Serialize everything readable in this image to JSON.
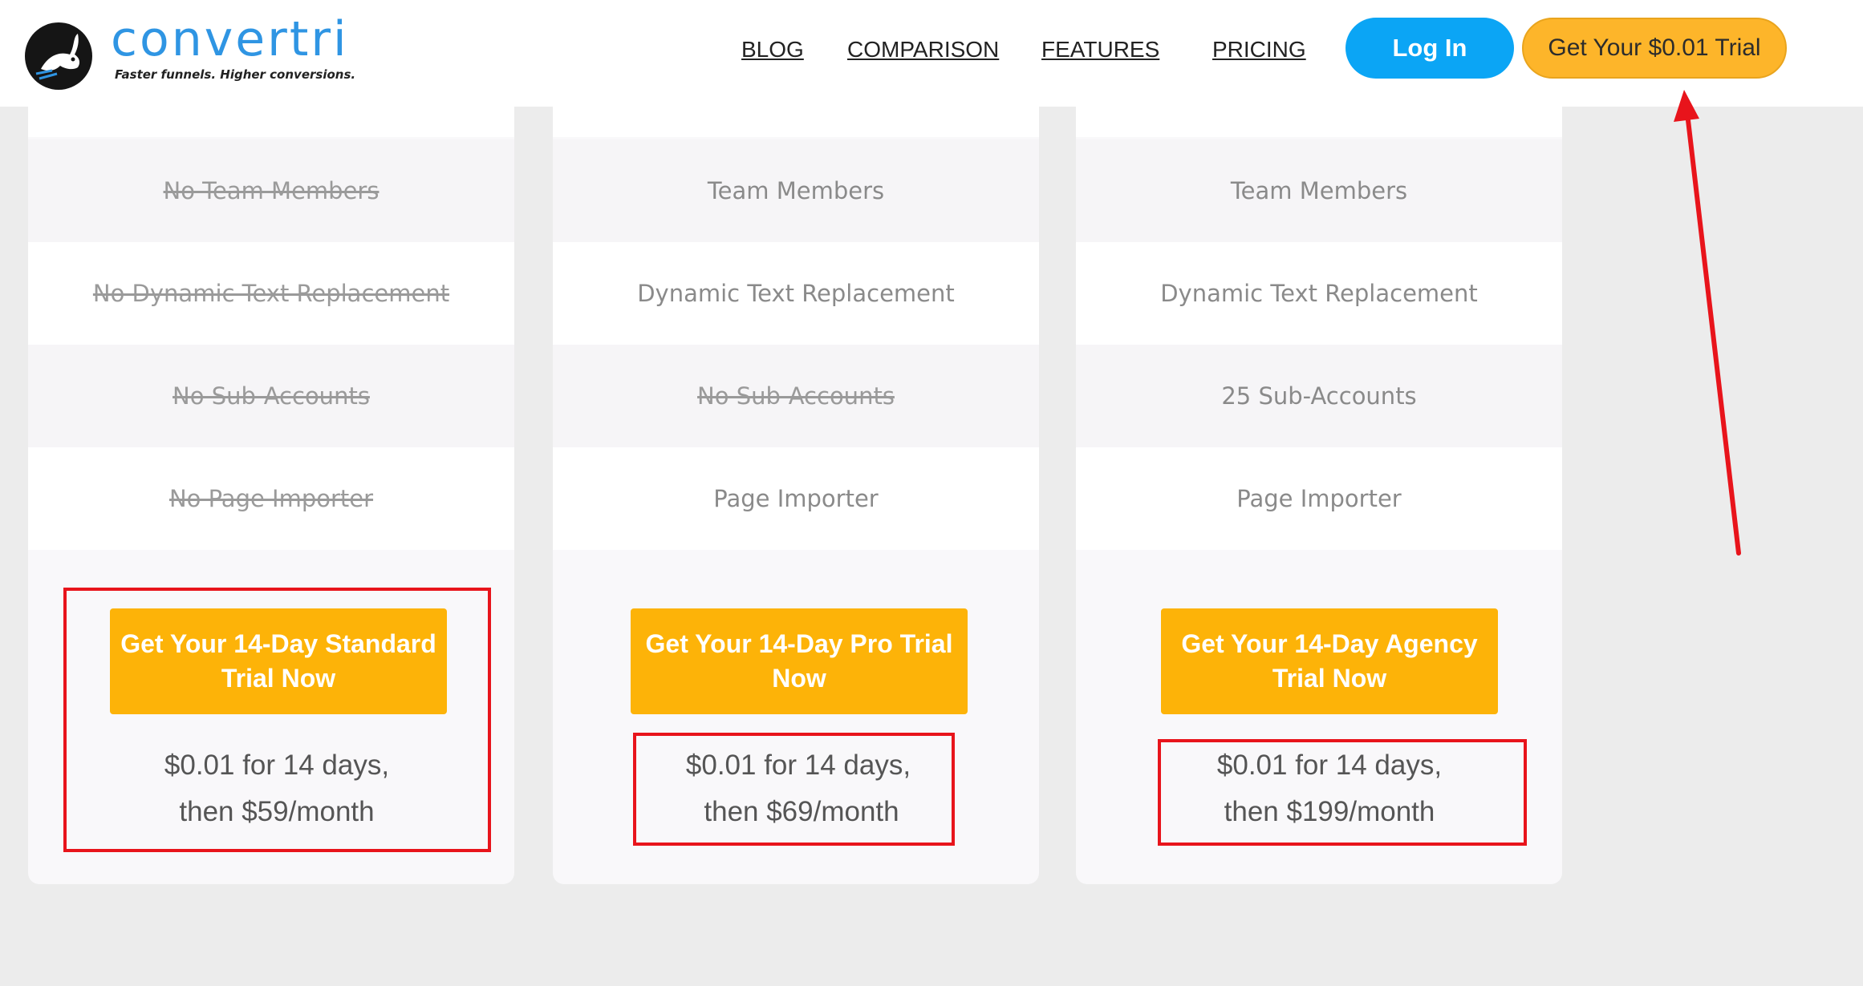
{
  "header": {
    "logo_text": "convertri",
    "tagline": "Faster funnels. Higher conversions.",
    "nav": [
      {
        "label": "BLOG"
      },
      {
        "label": "COMPARISON"
      },
      {
        "label": "FEATURES"
      },
      {
        "label": "PRICING"
      }
    ],
    "login_label": "Log In",
    "trial_label": "Get Your $0.01 Trial"
  },
  "plans": [
    {
      "features": [
        {
          "text": "No Team Members",
          "included": false
        },
        {
          "text": "No Dynamic Text Replacement",
          "included": false
        },
        {
          "text": "No Sub-Accounts",
          "included": false
        },
        {
          "text": "No Page Importer",
          "included": false
        }
      ],
      "cta_line1": "Get Your 14-Day Standard",
      "cta_line2": "Trial Now",
      "price_line1": "$0.01 for 14 days,",
      "price_line2": "then $59/month"
    },
    {
      "features": [
        {
          "text": "Team Members",
          "included": true
        },
        {
          "text": "Dynamic Text Replacement",
          "included": true
        },
        {
          "text": "No Sub-Accounts",
          "included": false
        },
        {
          "text": "Page Importer",
          "included": true
        }
      ],
      "cta_line1": "Get Your 14-Day Pro Trial",
      "cta_line2": "Now",
      "price_line1": "$0.01 for 14 days,",
      "price_line2": "then $69/month"
    },
    {
      "features": [
        {
          "text": "Team Members",
          "included": true
        },
        {
          "text": "Dynamic Text Replacement",
          "included": true
        },
        {
          "text": "25 Sub-Accounts",
          "included": true
        },
        {
          "text": "Page Importer",
          "included": true
        }
      ],
      "cta_line1": "Get Your 14-Day Agency",
      "cta_line2": "Trial Now",
      "price_line1": "$0.01 for 14 days,",
      "price_line2": "then $199/month"
    }
  ],
  "colors": {
    "brand_blue": "#2f95e3",
    "login_blue": "#0ba5f5",
    "cta_orange": "#fdb308",
    "annotation_red": "#e8141b"
  }
}
